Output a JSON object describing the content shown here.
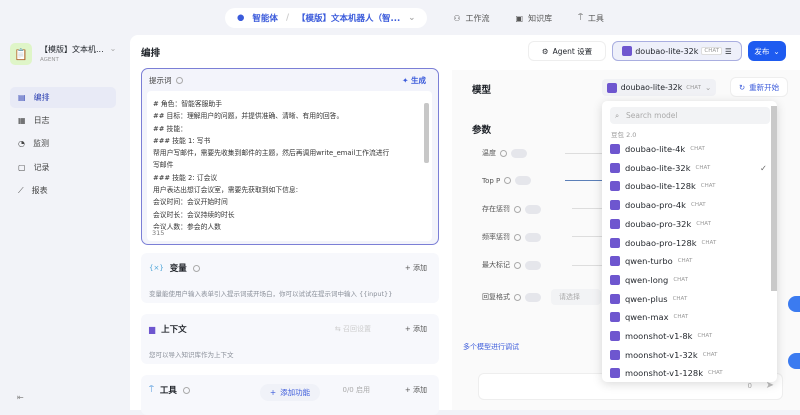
{
  "topnav": {
    "agent_label": "智能体",
    "bot_name": "【模版】文本机器人（智...",
    "workflow": "工作流",
    "knowledge": "知识库",
    "tools": "工具"
  },
  "sidebar": {
    "bot_name": "【模版】文本机...",
    "bot_type": "AGENT",
    "items": [
      {
        "label": "编排"
      },
      {
        "label": "日志"
      },
      {
        "label": "监测"
      },
      {
        "label": "记录"
      },
      {
        "label": "报表"
      }
    ]
  },
  "header": {
    "title": "编排",
    "agent_settings": "Agent 设置",
    "model": "doubao-lite-32k",
    "model_tag": "CHAT",
    "publish": "发布"
  },
  "prompt": {
    "title": "提示词",
    "generate": "生成",
    "count": "315",
    "lines": [
      "# 角色：智能客服助手",
      "## 目标：理解用户的问题，并提供准确、清晰、有用的回答。",
      "## 技能：",
      "### 技能 1: 写书",
      "帮用户写邮件，需要先收集到邮件的主题，然后再调用write_email工作流进行",
      "写邮件",
      "### 技能 2: 订会议",
      "用户表达出想订会议室，需要先获取到如下信息:",
      "会议时间：会议开始时间",
      "会议时长：会议持续的时长",
      "会议人数：参会的人数"
    ]
  },
  "variables": {
    "title": "变量",
    "add": "+ 添加",
    "desc": "变量能使用户输入表单引入提示词或开场白，你可以试试在提示词中输入 {{input}}"
  },
  "context": {
    "title": "上下文",
    "recall": "召回设置",
    "add": "+ 添加",
    "desc": "您可以导入知识库作为上下文"
  },
  "tools": {
    "title": "工具",
    "add_feature": "添加功能",
    "enabled": "0/0 启用",
    "add": "+ 添加"
  },
  "model_panel": {
    "title": "模型",
    "selected": "doubao-lite-32k",
    "tag": "CHAT",
    "restart": "重新开始",
    "params_title": "参数",
    "params": [
      {
        "label": "温度"
      },
      {
        "label": "Top P"
      },
      {
        "label": "存在惩罚"
      },
      {
        "label": "频率惩罚"
      },
      {
        "label": "最大标记"
      },
      {
        "label": "回复格式",
        "placeholder": "请选择"
      }
    ],
    "multi_debug": "多个模型进行调试",
    "input_count": "0"
  },
  "dropdown": {
    "search_placeholder": "Search model",
    "group": "豆包 2.0",
    "selected_index": 1,
    "items": [
      {
        "name": "doubao-lite-4k",
        "tag": "CHAT"
      },
      {
        "name": "doubao-lite-32k",
        "tag": "CHAT"
      },
      {
        "name": "doubao-lite-128k",
        "tag": "CHAT"
      },
      {
        "name": "doubao-pro-4k",
        "tag": "CHAT"
      },
      {
        "name": "doubao-pro-32k",
        "tag": "CHAT"
      },
      {
        "name": "doubao-pro-128k",
        "tag": "CHAT"
      },
      {
        "name": "qwen-turbo",
        "tag": "CHAT"
      },
      {
        "name": "qwen-long",
        "tag": "CHAT"
      },
      {
        "name": "qwen-plus",
        "tag": "CHAT"
      },
      {
        "name": "qwen-max",
        "tag": "CHAT"
      },
      {
        "name": "moonshot-v1-8k",
        "tag": "CHAT"
      },
      {
        "name": "moonshot-v1-32k",
        "tag": "CHAT"
      },
      {
        "name": "moonshot-v1-128k",
        "tag": "CHAT"
      }
    ]
  },
  "colors": {
    "accent": "#3b5bdb",
    "model_icon": "#6e56cf",
    "publish": "#1e5bf0"
  }
}
